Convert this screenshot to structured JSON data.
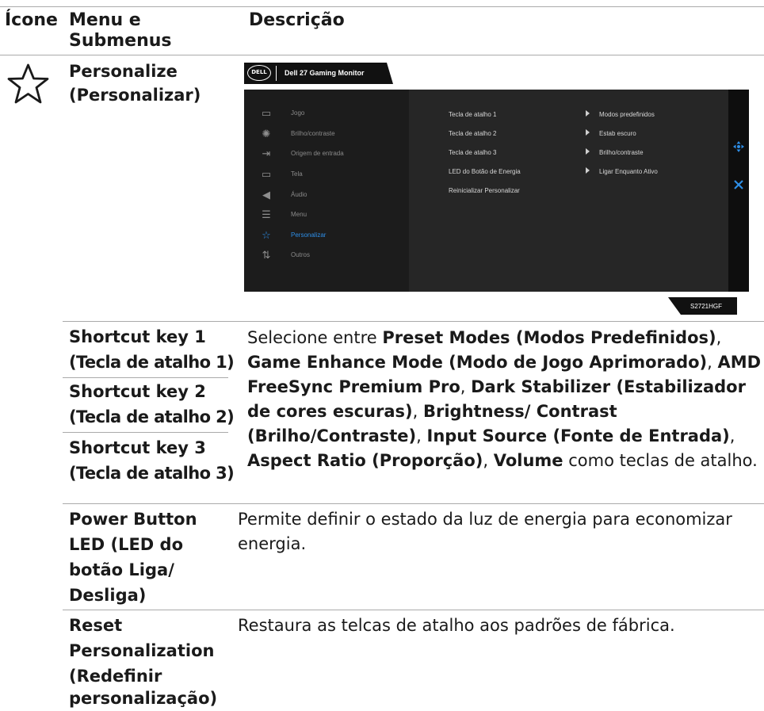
{
  "headers": {
    "icon": "Ícone",
    "menu_line1": "Menu e",
    "menu_line2": "Submenus",
    "description": "Descrição"
  },
  "section": {
    "icon": "star-outline-icon",
    "title_line1": "Personalize",
    "title_line2": "(Personalizar)"
  },
  "osd": {
    "brand": "DELL",
    "title": "Dell 27 Gaming Monitor",
    "model": "S2721HGF",
    "accent_color": "#2e8ee6",
    "menu": [
      {
        "icon": "gamepad-icon",
        "glyph": "▭",
        "label": "Jogo"
      },
      {
        "icon": "brightness-icon",
        "glyph": "✺",
        "label": "Brilho/contraste"
      },
      {
        "icon": "input-source-icon",
        "glyph": "⇥",
        "label": "Origem de entrada"
      },
      {
        "icon": "display-icon",
        "glyph": "▭",
        "label": "Tela"
      },
      {
        "icon": "speaker-icon",
        "glyph": "◀)",
        "label": "Áudio"
      },
      {
        "icon": "menu-icon",
        "glyph": "☰",
        "label": "Menu"
      },
      {
        "icon": "star-icon",
        "glyph": "☆",
        "label": "Personalizar"
      },
      {
        "icon": "others-icon",
        "glyph": "⇅",
        "label": "Outros"
      }
    ],
    "rows": [
      {
        "label": "Tecla de atalho 1",
        "value": "Modos predefinidos"
      },
      {
        "label": "Tecla de atalho 2",
        "value": "Estab escuro"
      },
      {
        "label": "Tecla de atalho 3",
        "value": "Brilho/contraste"
      },
      {
        "label": "LED do Botão de Energia",
        "value": "Ligar Enquanto Ativo"
      },
      {
        "label": "Reinicializar Personalizar",
        "value": ""
      }
    ],
    "nav_icons": [
      "move-icon",
      "close-icon"
    ]
  },
  "items": {
    "sk1_l1": "Shortcut key 1",
    "sk1_l2": "(Tecla de atalho 1)",
    "sk2_l1": "Shortcut key 2",
    "sk2_l2": "(Tecla de atalho 2)",
    "sk3_l1": "Shortcut key 3",
    "sk3_l2": "(Tecla de atalho 3)",
    "sk_desc": {
      "intro": "Selecione entre ",
      "b1": "Preset Modes (Modos Predefinidos)",
      "s1": ", ",
      "b2": "Game Enhance Mode (Modo de Jogo Aprimorado)",
      "s2": ", ",
      "b3": "AMD FreeSync Premium Pro",
      "s3": ", ",
      "b4": "Dark Stabilizer (Estabilizador de cores escuras)",
      "s4": ", ",
      "b5": "Brightness/ Contrast (Brilho/Contraste)",
      "s5": ", ",
      "b6": "Input Source (Fonte de Entrada)",
      "s6": ", ",
      "b7": "Aspect Ratio (Proporção)",
      "s7": ", ",
      "b8": "Volume",
      "outro": " como teclas de atalho."
    },
    "led_l1": "Power Button",
    "led_l2": "LED (LED do",
    "led_l3": "botão Liga/",
    "led_l4": "Desliga)",
    "led_desc": "Permite definir o estado da luz de energia para economizar energia.",
    "reset_l1": "Reset",
    "reset_l2": "Personalization",
    "reset_l3": "(Redefinir",
    "reset_l4": "personalização)",
    "reset_desc": "Restaura as telcas de atalho aos padrões de fábrica."
  }
}
